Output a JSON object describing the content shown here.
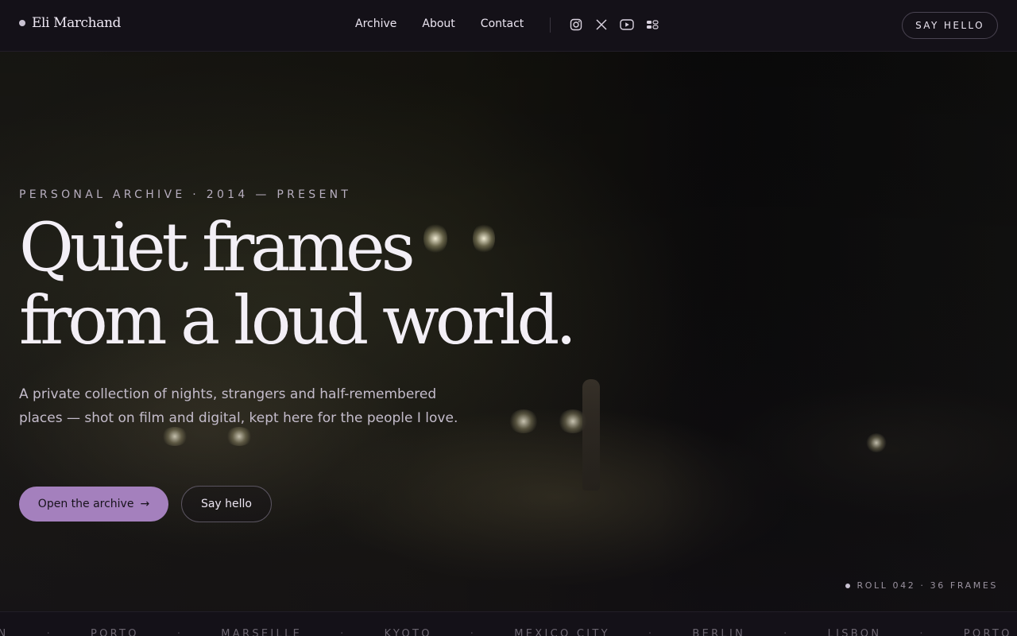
{
  "brand": {
    "name": "Eli Marchand"
  },
  "nav": {
    "links": [
      {
        "label": "Archive"
      },
      {
        "label": "About"
      },
      {
        "label": "Contact"
      }
    ],
    "social": [
      "instagram-icon",
      "x-icon",
      "youtube-icon",
      "flickr-icon"
    ],
    "cta_label": "SAY HELLO"
  },
  "hero": {
    "eyebrow": "PERSONAL ARCHIVE · 2014 — PRESENT",
    "headline_line1": "Quiet frames",
    "headline_line2": "from a loud world.",
    "lede": "A private collection of nights, strangers and half-remembered places — shot on film and digital, kept here for the people I love.",
    "primary_cta": "Open the archive",
    "primary_cta_arrow": "→",
    "secondary_cta": "Say hello",
    "roll_indicator": "ROLL 042 · 36 FRAMES"
  },
  "ticker": {
    "items": [
      "ON",
      "PORTO",
      "MARSEILLE",
      "KYOTO",
      "MEXICO CITY",
      "BERLIN",
      "LISBON",
      "PORTO"
    ],
    "separator": "·"
  },
  "colors": {
    "accent": "#a480bd",
    "background": "#141118",
    "text": "#ece6f2"
  }
}
